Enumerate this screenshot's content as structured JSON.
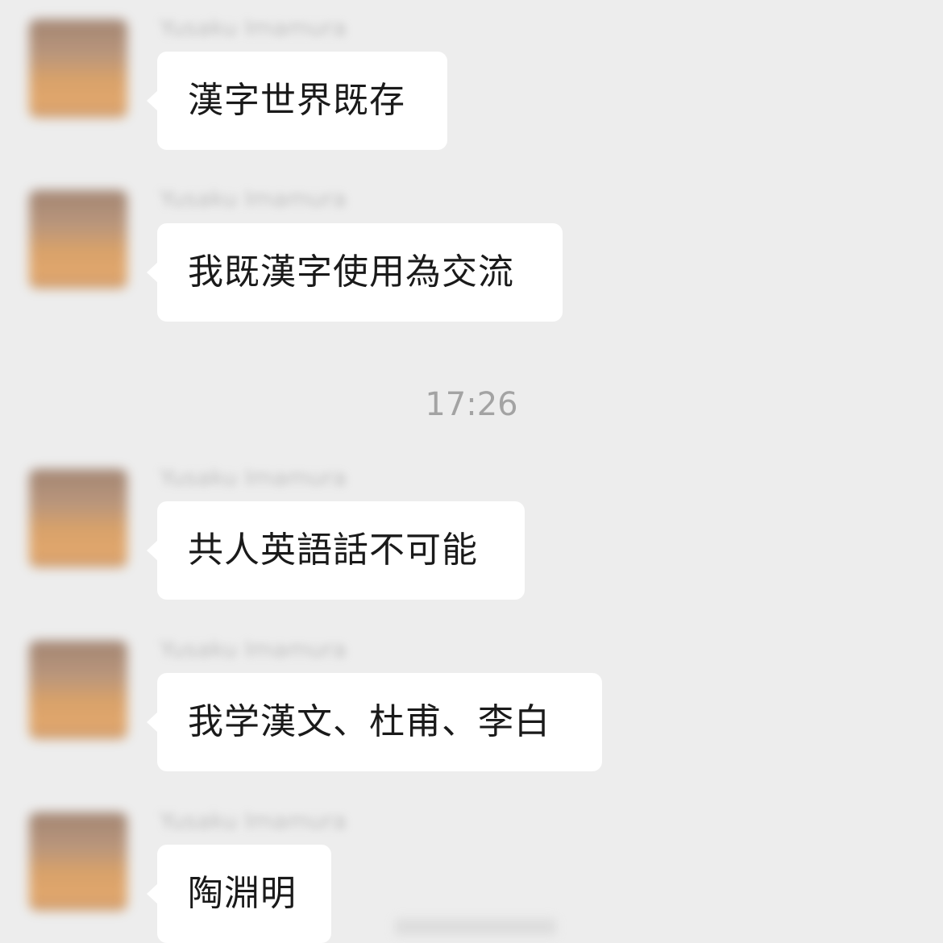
{
  "messages": [
    {
      "sender": "Yusaku Imamura",
      "text": "漢字世界既存"
    },
    {
      "sender": "Yusaku Imamura",
      "text": "我既漢字使用為交流"
    },
    {
      "sender": "Yusaku Imamura",
      "text": "共人英語話不可能"
    },
    {
      "sender": "Yusaku Imamura",
      "text": "我学漢文、杜甫、李白"
    },
    {
      "sender": "Yusaku Imamura",
      "text": "陶淵明"
    }
  ],
  "timestamp": "17:26",
  "colors": {
    "background": "#ededed",
    "bubble": "#ffffff",
    "text": "#1a1a1a",
    "timestamp": "#a3a3a3"
  },
  "icons": {
    "avatar": "blurred-profile-photo"
  }
}
